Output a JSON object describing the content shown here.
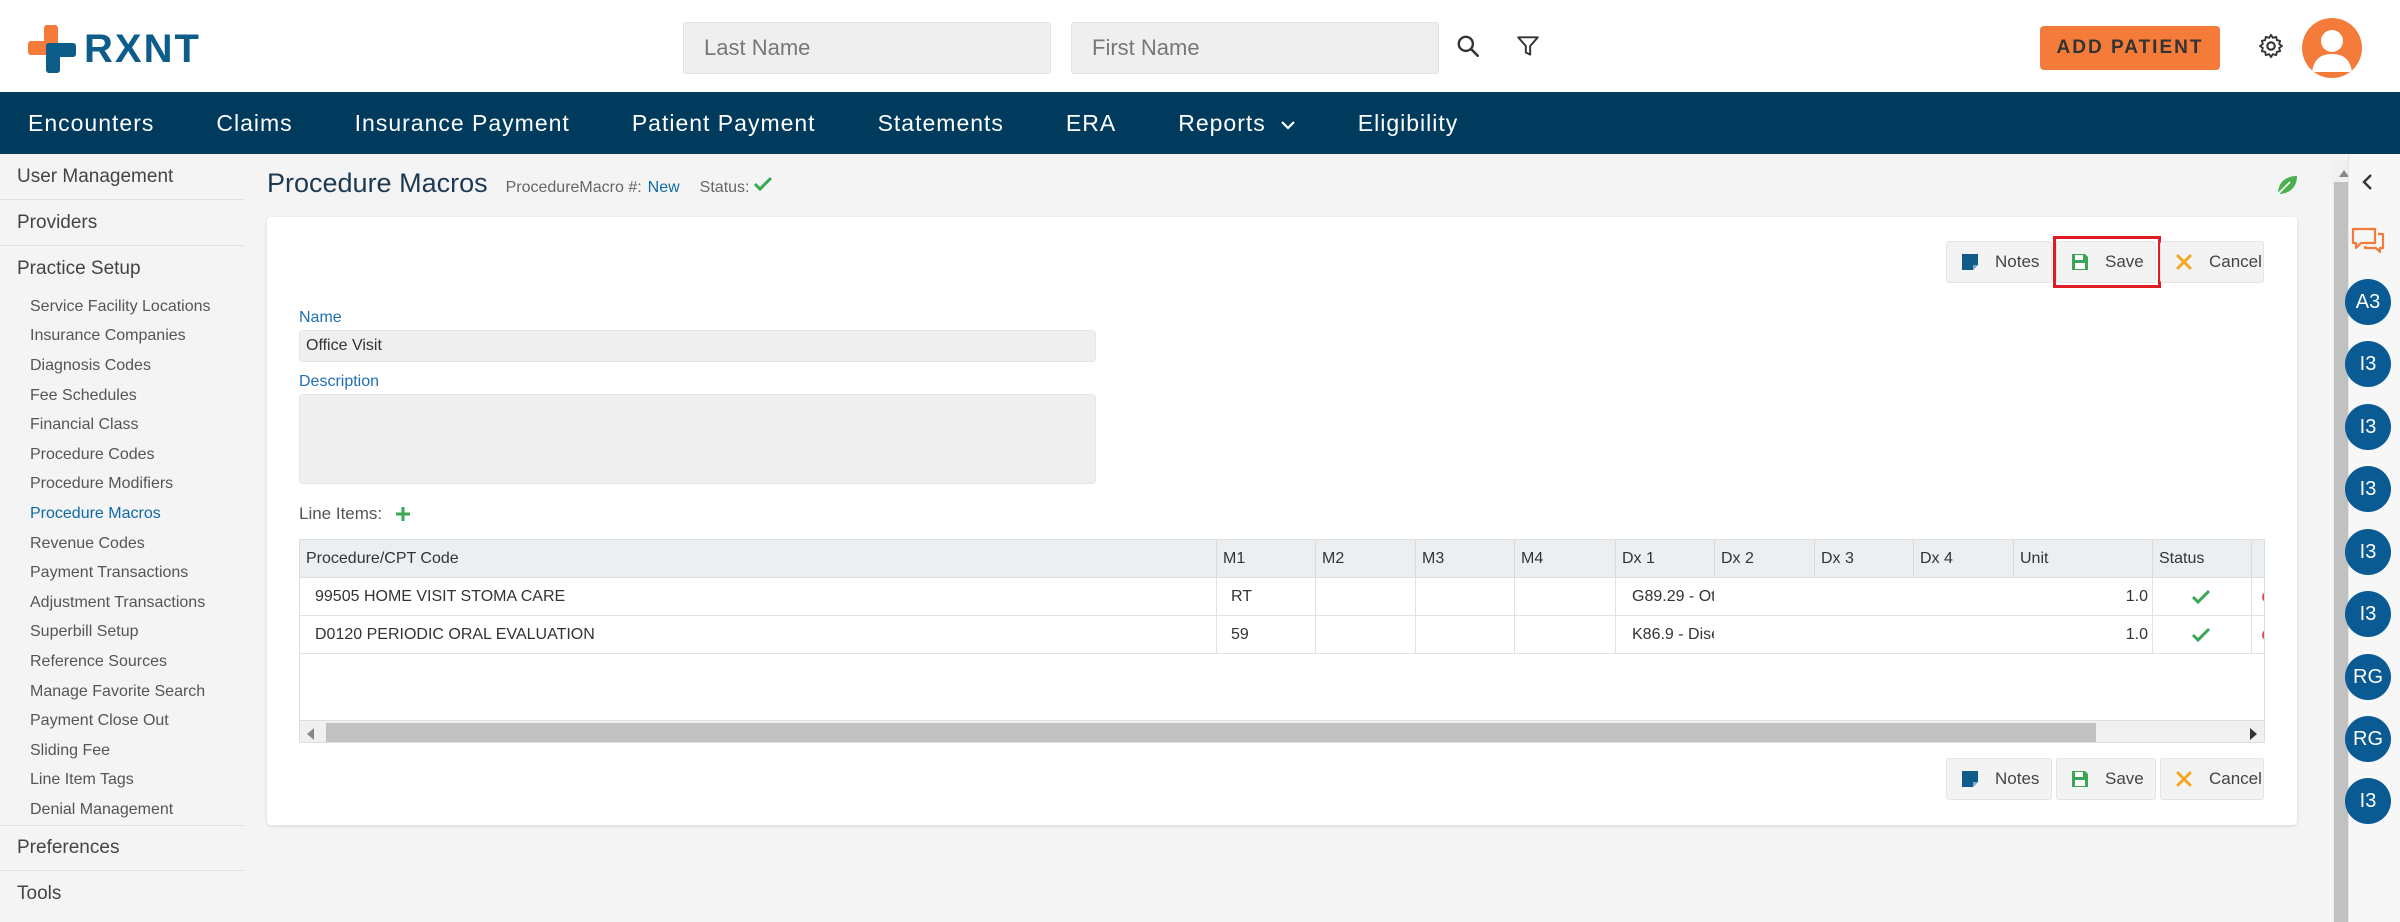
{
  "header": {
    "logo_text": "RXNT",
    "last_name_placeholder": "Last Name",
    "first_name_placeholder": "First Name",
    "add_patient_label": "ADD PATIENT"
  },
  "nav": {
    "items": [
      "Encounters",
      "Claims",
      "Insurance Payment",
      "Patient Payment",
      "Statements",
      "ERA",
      "Reports",
      "Eligibility"
    ]
  },
  "sidebar": {
    "sections": {
      "user_management": "User Management",
      "providers": "Providers",
      "practice_setup": "Practice Setup",
      "preferences": "Preferences",
      "tools": "Tools"
    },
    "items": [
      "Service Facility Locations",
      "Insurance Companies",
      "Diagnosis Codes",
      "Fee Schedules",
      "Financial Class",
      "Procedure Codes",
      "Procedure Modifiers",
      "Procedure Macros",
      "Revenue Codes",
      "Payment Transactions",
      "Adjustment Transactions",
      "Superbill Setup",
      "Reference Sources",
      "Manage Favorite Search",
      "Payment Close Out",
      "Sliding Fee",
      "Line Item Tags",
      "Denial Management"
    ],
    "active_item": "Procedure Macros"
  },
  "page": {
    "title": "Procedure Macros",
    "macro_label": "ProcedureMacro #:",
    "macro_value": "New",
    "status_label": "Status:"
  },
  "toolbar": {
    "notes_label": "Notes",
    "save_label": "Save",
    "cancel_label": "Cancel"
  },
  "form": {
    "name_label": "Name",
    "name_value": "Office Visit",
    "description_label": "Description",
    "description_value": "",
    "line_items_label": "Line Items:"
  },
  "table": {
    "columns": [
      "Procedure/CPT Code",
      "M1",
      "M2",
      "M3",
      "M4",
      "Dx 1",
      "Dx 2",
      "Dx 3",
      "Dx 4",
      "Unit",
      "Status"
    ],
    "rows": [
      {
        "code": "99505 HOME VISIT STOMA CARE",
        "m1": "RT",
        "m2": "",
        "m3": "",
        "m4": "",
        "dx1": "G89.29 - Ot",
        "dx2": "",
        "dx3": "",
        "dx4": "",
        "unit": "1.0"
      },
      {
        "code": "D0120 PERIODIC ORAL EVALUATION",
        "m1": "59",
        "m2": "",
        "m3": "",
        "m4": "",
        "dx1": "K86.9 - Dise",
        "dx2": "",
        "dx3": "",
        "dx4": "",
        "unit": "1.0"
      }
    ]
  },
  "right_rail": {
    "bubbles": [
      "A3",
      "I3",
      "I3",
      "I3",
      "I3",
      "I3",
      "RG",
      "RG",
      "I3"
    ]
  },
  "colors": {
    "brand_orange": "#f47b3a",
    "brand_blue": "#0e5c8a",
    "nav_bg": "#003a5d",
    "highlight": "#e01b24",
    "success": "#3aa757"
  }
}
